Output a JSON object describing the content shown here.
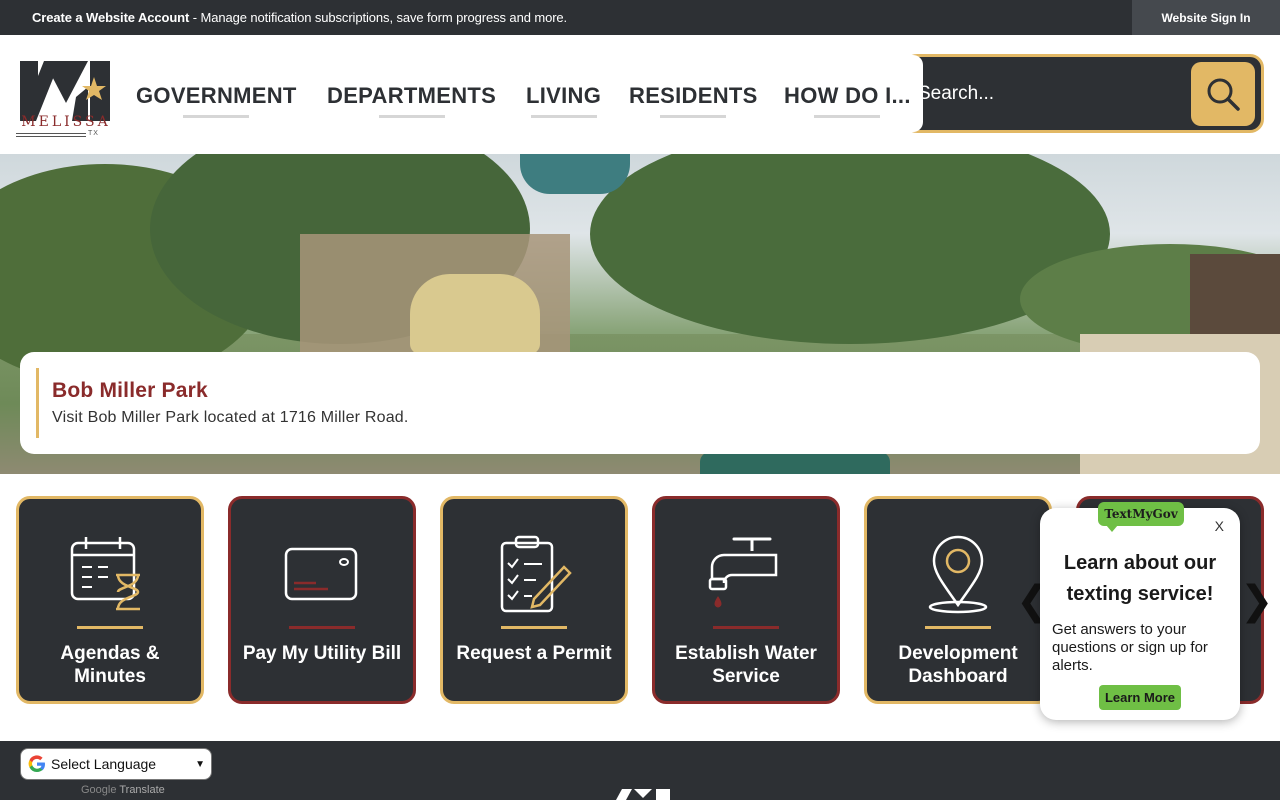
{
  "topbar": {
    "create_account": "Create a Website Account",
    "message": " - Manage notification subscriptions, save form progress and more.",
    "sign_in": "Website Sign In"
  },
  "logo": {
    "name": "MELISSA",
    "state": "TX",
    "icon": "melissa-m-star-logo"
  },
  "nav": {
    "items": [
      {
        "label": "GOVERNMENT"
      },
      {
        "label": "DEPARTMENTS"
      },
      {
        "label": "LIVING"
      },
      {
        "label": "RESIDENTS"
      },
      {
        "label": "HOW DO I..."
      }
    ]
  },
  "search": {
    "placeholder": "Search...",
    "icon": "search-icon"
  },
  "hero": {
    "title": "Bob Miller Park",
    "description": "Visit Bob Miller Park located at 1716 Miller Road."
  },
  "quick_links": [
    {
      "label": "Agendas & Minutes",
      "icon": "calendar-hourglass-icon",
      "accent": "#e2b865"
    },
    {
      "label": "Pay My Utility Bill",
      "icon": "credit-card-icon",
      "accent": "#8a2b2b"
    },
    {
      "label": "Request a Permit",
      "icon": "clipboard-pencil-icon",
      "accent": "#e2b865"
    },
    {
      "label": "Establish Water Service",
      "icon": "water-faucet-icon",
      "accent": "#8a2b2b"
    },
    {
      "label": "Development Dashboard",
      "icon": "map-pin-icon",
      "accent": "#e2b865"
    }
  ],
  "popup": {
    "brand": "TextMyGov",
    "close": "X",
    "heading": "Learn about our texting service!",
    "body": "Get answers to your questions or sign up for alerts.",
    "button": "Learn More"
  },
  "footer": {
    "language": "Select Language",
    "powered_by": "Google",
    "translate": "Translate"
  },
  "colors": {
    "dark": "#2d3034",
    "gold": "#e2b865",
    "maroon": "#8a2b2b",
    "green": "#6fbf45"
  }
}
